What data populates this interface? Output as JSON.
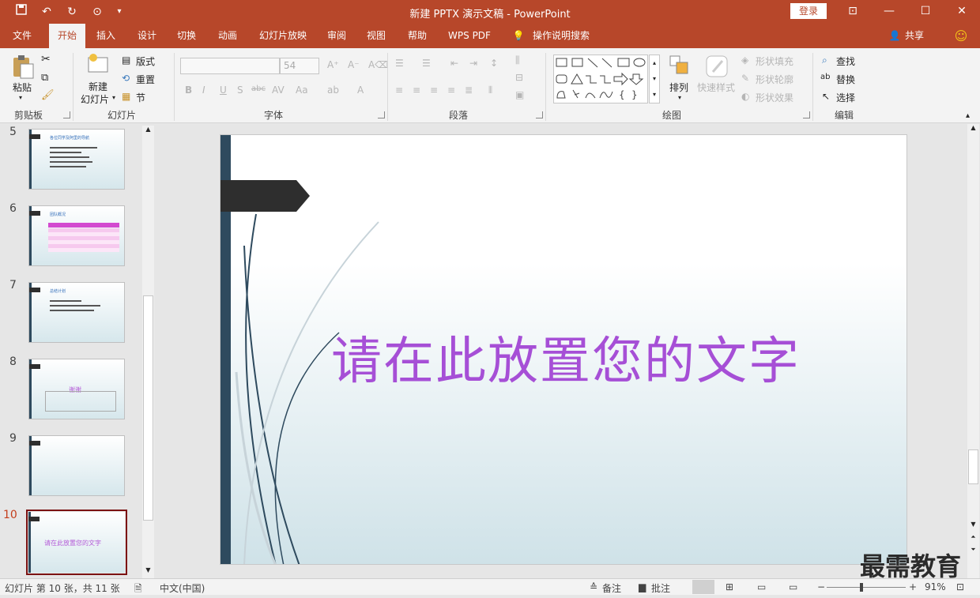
{
  "titlebar": {
    "title": "新建 PPTX 演示文稿  -  PowerPoint",
    "login": "登录"
  },
  "tabs": [
    "文件",
    "开始",
    "插入",
    "设计",
    "切换",
    "动画",
    "幻灯片放映",
    "审阅",
    "视图",
    "帮助",
    "WPS PDF",
    "操作说明搜索"
  ],
  "share": "共享",
  "ribbon": {
    "clipboard": {
      "paste": "粘贴",
      "label": "剪贴板"
    },
    "slides": {
      "new1": "新建",
      "new2": "幻灯片",
      "layout": "版式",
      "reset": "重置",
      "section": "节",
      "label": "幻灯片"
    },
    "font": {
      "size": "54",
      "label": "字体"
    },
    "paragraph": {
      "label": "段落"
    },
    "drawing": {
      "arrange": "排列",
      "quick": "快速样式",
      "fill": "形状填充",
      "outline": "形状轮廓",
      "effect": "形状效果",
      "label": "绘图"
    },
    "editing": {
      "find": "查找",
      "replace": "替换",
      "select": "选择",
      "label": "编辑"
    }
  },
  "thumbnails": [
    {
      "num": "5",
      "title": "各位同学及阿里的导航",
      "lines": 5
    },
    {
      "num": "6",
      "title": "团队概况",
      "lines": 0
    },
    {
      "num": "7",
      "title": "总结计划",
      "lines": 3
    },
    {
      "num": "8",
      "title": "谢谢",
      "lines": 0
    },
    {
      "num": "9",
      "title": "",
      "lines": 0
    },
    {
      "num": "10",
      "title": "请在此放置您的文字",
      "lines": 0
    }
  ],
  "slide": {
    "title": "请在此放置您的文字"
  },
  "status": {
    "slide": "幻灯片 第 10 张，共 11 张",
    "lang": "中文(中国)",
    "notes": "备注",
    "comments": "批注",
    "zoom": "91%"
  },
  "watermark": "最需教育",
  "colors": {
    "accent": "#b7472a",
    "title": "#a64fd6"
  }
}
